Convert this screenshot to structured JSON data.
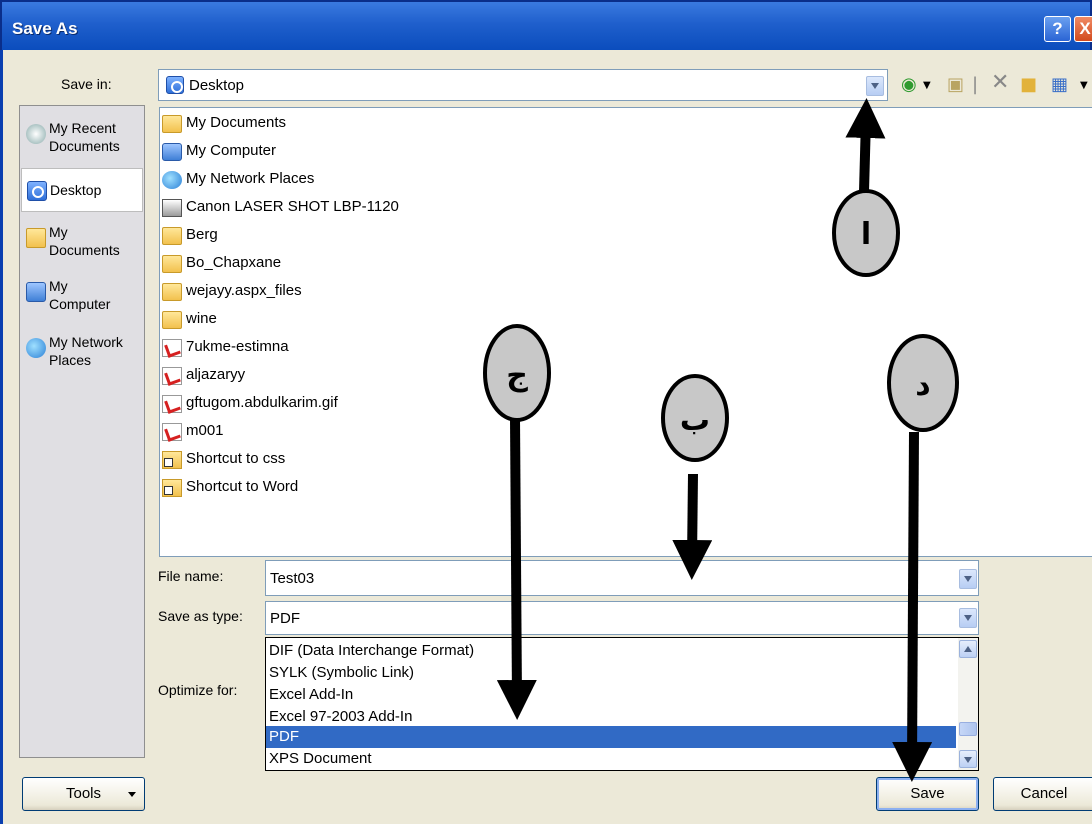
{
  "window": {
    "title": "Save As",
    "help_glyph": "?",
    "close_glyph": "X"
  },
  "save_in": {
    "label": "Save in:",
    "value": "Desktop"
  },
  "places": [
    {
      "label": "My Recent\nDocuments",
      "icon": "recent-documents-icon"
    },
    {
      "label": "Desktop",
      "icon": "desktop-icon"
    },
    {
      "label": "My\nDocuments",
      "icon": "my-documents-icon"
    },
    {
      "label": "My\nComputer",
      "icon": "my-computer-icon"
    },
    {
      "label": "My Network\nPlaces",
      "icon": "network-places-icon"
    }
  ],
  "files": [
    {
      "name": "My Documents",
      "icon": "documents"
    },
    {
      "name": "My Computer",
      "icon": "computer"
    },
    {
      "name": "My Network Places",
      "icon": "network"
    },
    {
      "name": "Canon LASER SHOT LBP-1120",
      "icon": "printer"
    },
    {
      "name": "Berg",
      "icon": "folder"
    },
    {
      "name": "Bo_Chapxane",
      "icon": "folder"
    },
    {
      "name": "wejayy.aspx_files",
      "icon": "folder"
    },
    {
      "name": "wine",
      "icon": "folder"
    },
    {
      "name": "7ukme-estimna",
      "icon": "pdf"
    },
    {
      "name": "aljazaryy",
      "icon": "pdf"
    },
    {
      "name": "gftugom.abdulkarim.gif",
      "icon": "pdf"
    },
    {
      "name": "m001",
      "icon": "pdf"
    },
    {
      "name": "Shortcut to css",
      "icon": "shortcut"
    },
    {
      "name": "Shortcut to Word",
      "icon": "shortcut"
    }
  ],
  "file_name": {
    "label": "File name:",
    "value": "Test03"
  },
  "save_as_type": {
    "label": "Save as type:",
    "value": "PDF"
  },
  "optimize_for": {
    "label": "Optimize for:"
  },
  "type_options": [
    "DIF (Data Interchange Format)",
    "SYLK (Symbolic Link)",
    "Excel Add-In",
    "Excel 97-2003 Add-In",
    "PDF",
    "XPS Document"
  ],
  "selected_type_index": 4,
  "buttons": {
    "tools": "Tools",
    "save": "Save",
    "cancel": "Cancel"
  },
  "annotations": [
    "ا",
    "ب",
    "ج",
    "د"
  ]
}
